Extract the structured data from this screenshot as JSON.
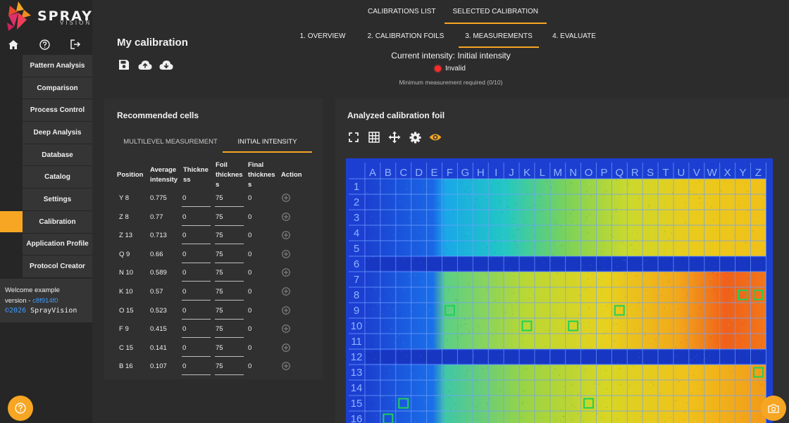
{
  "brand": {
    "name": "SPRAY",
    "sub": "VISION"
  },
  "sidebar": {
    "top_icons": [
      "home-icon",
      "help-icon",
      "logout-icon"
    ],
    "items": [
      {
        "label": "Pattern Analysis"
      },
      {
        "label": "Comparison"
      },
      {
        "label": "Process Control"
      },
      {
        "label": "Deep Analysis"
      },
      {
        "label": "Database"
      },
      {
        "label": "Catalog"
      },
      {
        "label": "Settings"
      },
      {
        "label": "Calibration",
        "active": true
      },
      {
        "label": "Application Profile"
      },
      {
        "label": "Protocol Creator"
      }
    ],
    "welcome": "Welcome example",
    "version_prefix": "version - ",
    "version_hash": "c8f914f0",
    "copyright_year": "©2026",
    "copyright_name": " SprayVision"
  },
  "top_tabs": [
    {
      "label": "CALIBRATIONS LIST"
    },
    {
      "label": "SELECTED CALIBRATION",
      "active": true
    }
  ],
  "sub_tabs": [
    {
      "label": "1. OVERVIEW"
    },
    {
      "label": "2. CALIBRATION FOILS"
    },
    {
      "label": "3. MEASUREMENTS",
      "active": true
    },
    {
      "label": "4. EVALUATE"
    }
  ],
  "page_title": "My calibration",
  "intensity": {
    "title": "Current intensity: Initial intensity",
    "status": "Invalid",
    "requirement": "Minimum measurement required (0/10)"
  },
  "recommended": {
    "title": "Recommended cells",
    "tabs": [
      {
        "label": "MULTILEVEL MEASUREMENT"
      },
      {
        "label": "INITIAL INTENSITY",
        "active": true
      }
    ],
    "columns": {
      "position": "Position",
      "avg1": "Average",
      "avg2": "intensity",
      "thk1": "Thickne",
      "thk2": "ss",
      "foil1": "Foil",
      "foil2": "thicknes",
      "foil3": "s",
      "fin1": "Final",
      "fin2": "thicknes",
      "fin3": "s",
      "action": "Action"
    },
    "rows": [
      {
        "position": "Y 8",
        "avg": "0.775",
        "thickness": "0",
        "foil": "75",
        "final": "0"
      },
      {
        "position": "Z 8",
        "avg": "0.77",
        "thickness": "0",
        "foil": "75",
        "final": "0"
      },
      {
        "position": "Z 13",
        "avg": "0.713",
        "thickness": "0",
        "foil": "75",
        "final": "0"
      },
      {
        "position": "Q 9",
        "avg": "0.66",
        "thickness": "0",
        "foil": "75",
        "final": "0"
      },
      {
        "position": "N 10",
        "avg": "0.589",
        "thickness": "0",
        "foil": "75",
        "final": "0"
      },
      {
        "position": "K 10",
        "avg": "0.57",
        "thickness": "0",
        "foil": "75",
        "final": "0"
      },
      {
        "position": "O 15",
        "avg": "0.523",
        "thickness": "0",
        "foil": "75",
        "final": "0"
      },
      {
        "position": "F 9",
        "avg": "0.415",
        "thickness": "0",
        "foil": "75",
        "final": "0"
      },
      {
        "position": "C 15",
        "avg": "0.141",
        "thickness": "0",
        "foil": "75",
        "final": "0"
      },
      {
        "position": "B 16",
        "avg": "0.107",
        "thickness": "0",
        "foil": "75",
        "final": "0"
      }
    ]
  },
  "foil": {
    "title": "Analyzed calibration foil",
    "toolbar_icons": [
      "fullscreen-icon",
      "grid-icon",
      "move-icon",
      "gear-icon",
      "eye-icon"
    ],
    "columns": [
      "A",
      "B",
      "C",
      "D",
      "E",
      "F",
      "G",
      "H",
      "I",
      "J",
      "K",
      "L",
      "M",
      "N",
      "O",
      "P",
      "Q",
      "R",
      "S",
      "T",
      "U",
      "V",
      "W",
      "X",
      "Y",
      "Z"
    ],
    "rows": [
      "1",
      "2",
      "3",
      "4",
      "5",
      "6",
      "7",
      "8",
      "9",
      "10",
      "11",
      "12",
      "13",
      "14",
      "15",
      "16"
    ],
    "empty_rows": [
      "6",
      "12"
    ],
    "highlighted_cells": [
      "Y 8",
      "Z 8",
      "F 9",
      "Q 9",
      "K 10",
      "N 10",
      "Z 13",
      "C 15",
      "O 15",
      "B 16"
    ],
    "colors": {
      "grid": "#6fa0ff",
      "highlight": "#1fd05a"
    }
  }
}
